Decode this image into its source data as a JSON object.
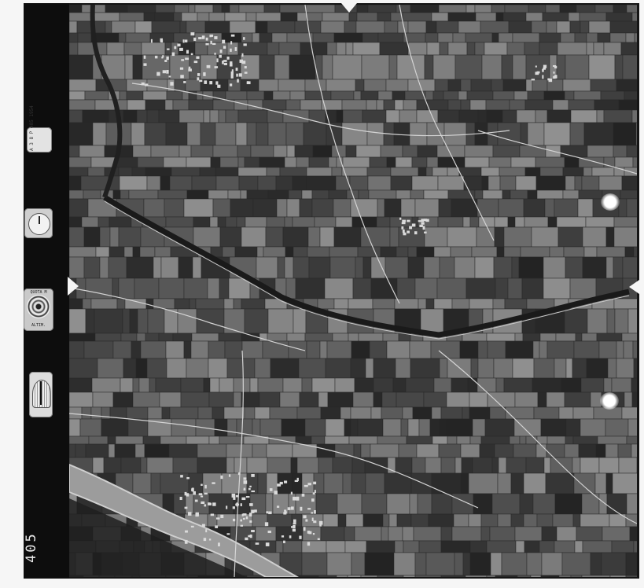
{
  "image": {
    "frame_number": "405",
    "data_strip": {
      "note_label": "A 3 8 P\n405\n1954",
      "altimeter_top": "QUOTA M",
      "altimeter_bottom": "ALTIM."
    },
    "features": {
      "river": "river-channel",
      "canal": "diagonal-canal",
      "towns": [
        "upper-village",
        "lower-village"
      ]
    },
    "colors": {
      "frame": "#151515",
      "paper": "#f6f6f6",
      "field_dark": "#2a2a2a",
      "field_light": "#8a8a8a",
      "water": "#9c9c9c"
    }
  }
}
